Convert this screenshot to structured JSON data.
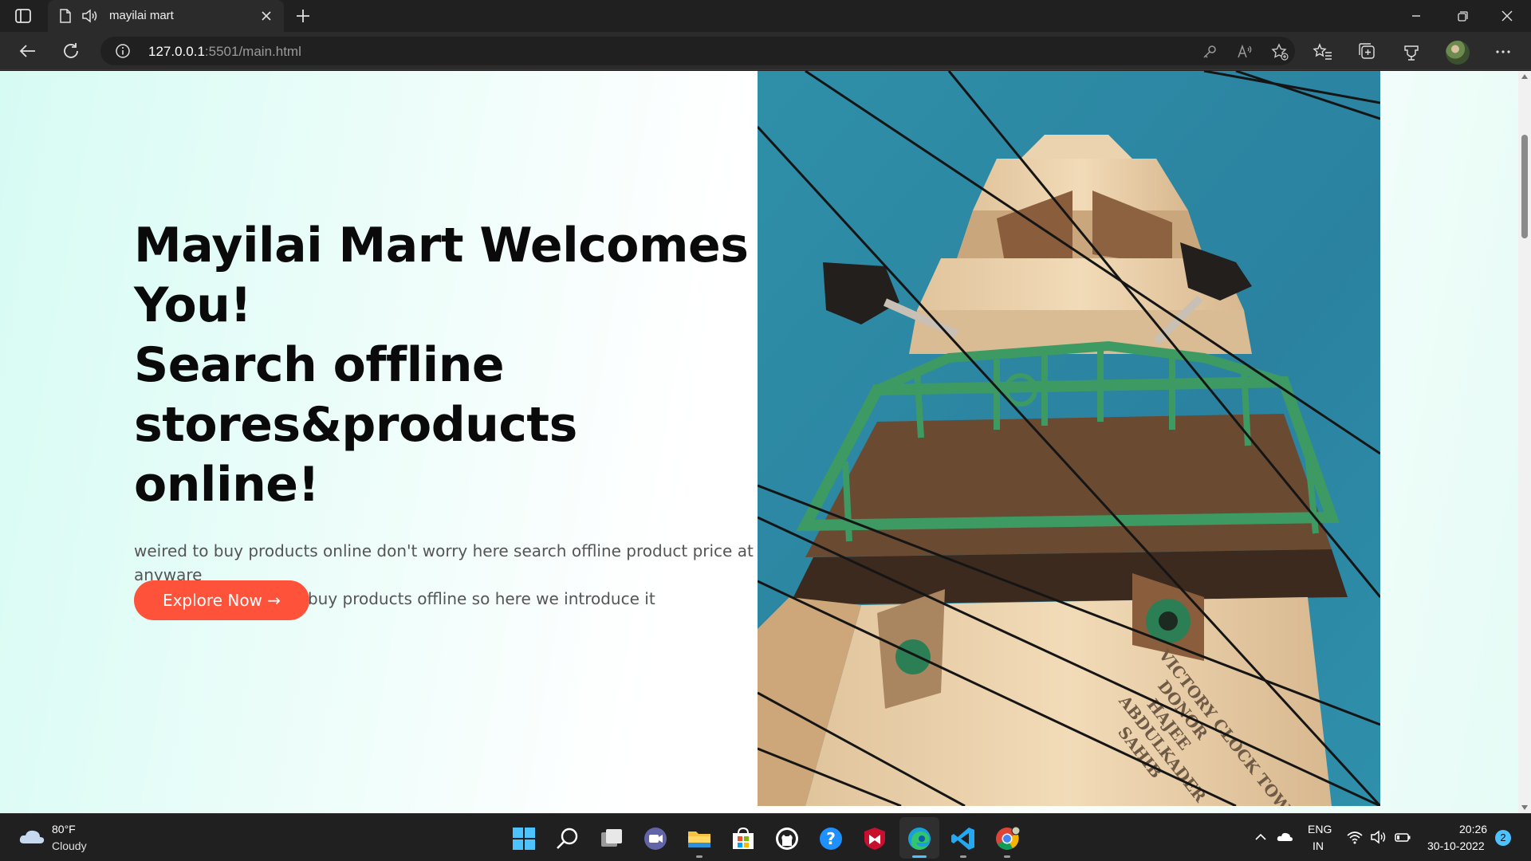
{
  "browser": {
    "tab_title": "mayilai mart",
    "url_host": "127.0.0.1",
    "url_rest": ":5501/main.html",
    "icons": [
      "sidebar-icon",
      "page-icon",
      "speaker-icon",
      "close-icon",
      "plus-icon",
      "minimize-icon",
      "maximize-icon",
      "close-window-icon",
      "back-icon",
      "reload-icon",
      "info-icon",
      "key-icon",
      "read-aloud-icon",
      "favorite-add-icon",
      "favorites-icon",
      "collections-icon",
      "extensions-icon",
      "avatar",
      "more-icon"
    ]
  },
  "hero": {
    "title_line1": "Mayilai Mart Welcomes You!",
    "title_line2": "Search offline stores&products online!",
    "desc_line1": "weired to buy products online don't worry here search offline product price at anyware",
    "desc_line2": "some peoples wanna buy products offline so here we introduce it",
    "button_label": "Explore Now →",
    "button_color": "#ff523b",
    "photo_text_line1": "VICTORY CLOCK TOWER",
    "photo_text_line2": "DONOR",
    "photo_text_line3": "HAJEE",
    "photo_text_line4": "ABDULKADER",
    "photo_text_line5": "SAHIB"
  },
  "taskbar": {
    "weather_temp": "80°F",
    "weather_condition": "Cloudy",
    "lang_line1": "ENG",
    "lang_line2": "IN",
    "time": "20:26",
    "date": "30-10-2022",
    "notification_count": "2",
    "accent_color": "#4cc2ff"
  }
}
